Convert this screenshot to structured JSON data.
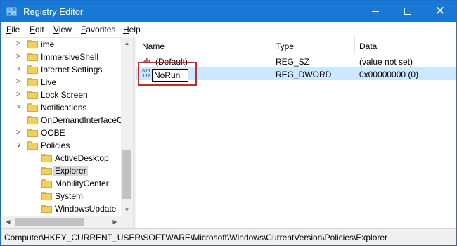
{
  "window": {
    "title": "Registry Editor"
  },
  "menu": [
    {
      "accel": "F",
      "rest": "ile"
    },
    {
      "accel": "E",
      "rest": "dit"
    },
    {
      "accel": "V",
      "rest": "iew"
    },
    {
      "accel": "F",
      "rest": "avorites",
      "pre": ""
    },
    {
      "accel": "H",
      "rest": "elp"
    }
  ],
  "tree": {
    "items": [
      {
        "label": "ime",
        "expandable": true
      },
      {
        "label": "ImmersiveShell",
        "expandable": true
      },
      {
        "label": "Internet Settings",
        "expandable": true
      },
      {
        "label": "Live",
        "expandable": true
      },
      {
        "label": "Lock Screen",
        "expandable": true
      },
      {
        "label": "Notifications",
        "expandable": true
      },
      {
        "label": "OnDemandInterfaceC",
        "expandable": false
      },
      {
        "label": "OOBE",
        "expandable": true
      },
      {
        "label": "Policies",
        "expandable": false,
        "expanded": true
      },
      {
        "label": "ActiveDesktop",
        "child": true
      },
      {
        "label": "Explorer",
        "child": true,
        "selected": true
      },
      {
        "label": "MobilityCenter",
        "child": true
      },
      {
        "label": "System",
        "child": true
      },
      {
        "label": "WindowsUpdate",
        "child": true
      }
    ]
  },
  "list": {
    "columns": {
      "name": "Name",
      "type": "Type",
      "data": "Data"
    },
    "rows": [
      {
        "name": "(Default)",
        "type": "REG_SZ",
        "data": "(value not set)",
        "icon": "string-value-icon"
      },
      {
        "name": "NoRun",
        "type": "REG_DWORD",
        "data": "0x00000000 (0)",
        "icon": "binary-value-icon",
        "editing": true
      }
    ]
  },
  "status": {
    "path": "Computer\\HKEY_CURRENT_USER\\SOFTWARE\\Microsoft\\Windows\\CurrentVersion\\Policies\\Explorer"
  },
  "colors": {
    "titlebar": "#1878d6",
    "selection": "#cce8ff",
    "highlight_box": "#e02020"
  }
}
